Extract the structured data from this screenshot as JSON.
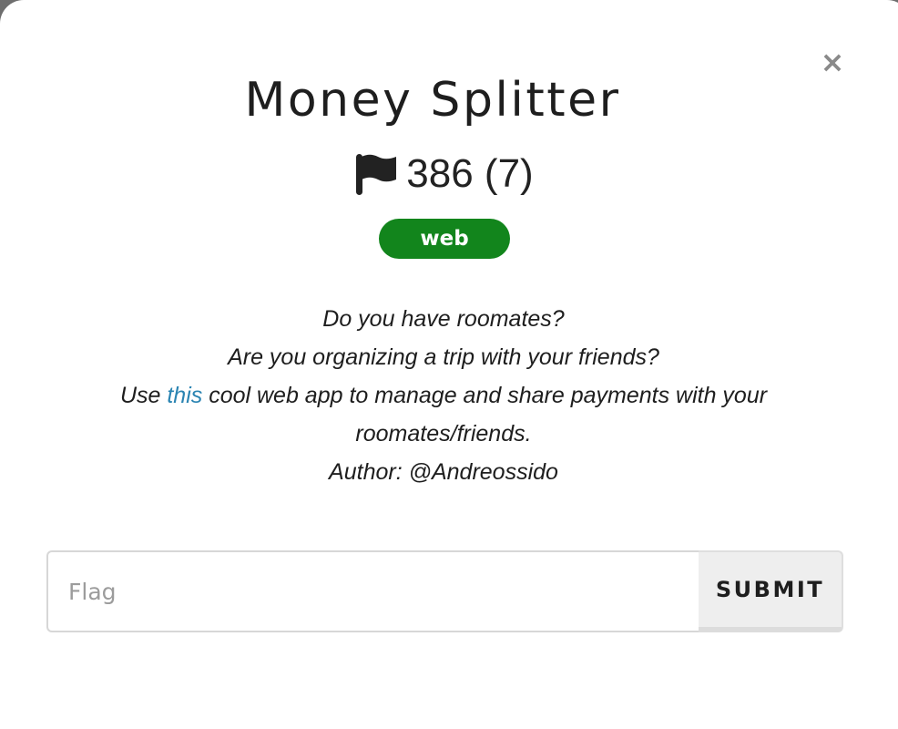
{
  "modal": {
    "close_label": "×",
    "title": "Money Splitter",
    "points": {
      "icon": "flag-icon",
      "text": "386 (7)"
    },
    "category": {
      "label": "web",
      "color": "#12851c"
    },
    "description": {
      "line1": "Do you have roomates?",
      "line2": "Are you organizing a trip with your friends?",
      "line3_before": "Use ",
      "line3_link": "this",
      "line3_after": " cool web app to manage and share payments with your roomates/friends.",
      "author": "Author: @Andreossido",
      "link_color": "#2a84b2"
    },
    "form": {
      "flag_value": "",
      "flag_placeholder": "Flag",
      "submit_label": "SUBMIT"
    }
  }
}
